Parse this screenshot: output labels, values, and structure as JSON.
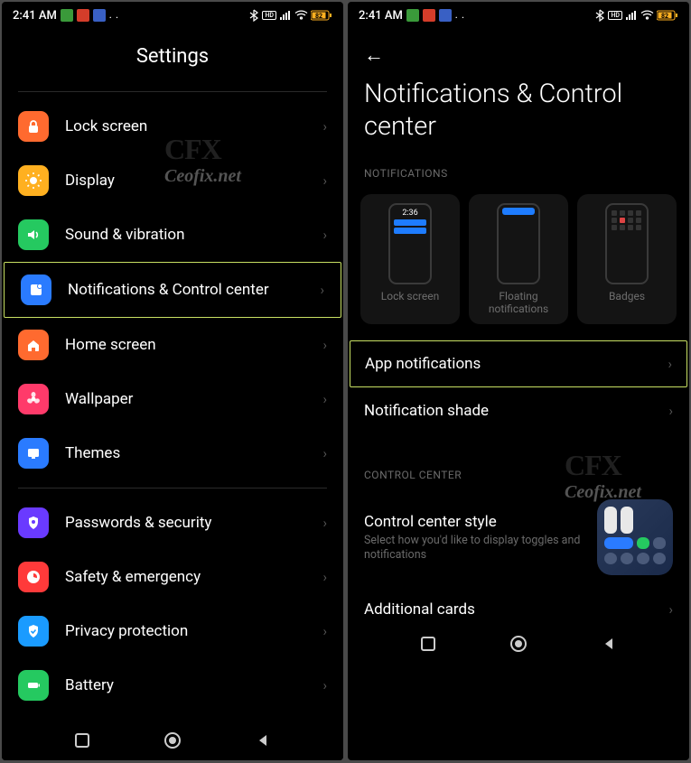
{
  "status": {
    "time": "2:41 AM",
    "app_icons": [
      "#3a9a3a",
      "#d43d2a",
      "#3960c4"
    ],
    "dots": ". .",
    "right_glyphs": [
      "bluetooth",
      "hd",
      "signal",
      "wifi",
      "battery"
    ],
    "battery_level": "82"
  },
  "left": {
    "title": "Settings",
    "items": [
      {
        "label": "Lock screen",
        "color": "#ff6a2f",
        "glyph": "lock"
      },
      {
        "label": "Display",
        "color": "#ffb020",
        "glyph": "sun"
      },
      {
        "label": "Sound & vibration",
        "color": "#25c960",
        "glyph": "sound"
      },
      {
        "label": "Notifications & Control center",
        "color": "#2a7bff",
        "glyph": "notif",
        "hl": true
      },
      {
        "label": "Home screen",
        "color": "#ff6a2f",
        "glyph": "home"
      },
      {
        "label": "Wallpaper",
        "color": "#ff3a6a",
        "glyph": "flower"
      },
      {
        "label": "Themes",
        "color": "#2a7bff",
        "glyph": "theme"
      }
    ],
    "items2": [
      {
        "label": "Passwords & security",
        "color": "#6a3aff",
        "glyph": "shield"
      },
      {
        "label": "Safety & emergency",
        "color": "#ff3a3a",
        "glyph": "safety"
      },
      {
        "label": "Privacy protection",
        "color": "#1a9bff",
        "glyph": "privacy"
      },
      {
        "label": "Battery",
        "color": "#25c960",
        "glyph": "battery"
      }
    ]
  },
  "right": {
    "title": "Notifications & Control center",
    "section1": "NOTIFICATIONS",
    "cards": [
      {
        "label": "Lock screen",
        "type": "lockscreen",
        "time": "2:36"
      },
      {
        "label": "Floating notifications",
        "type": "floating"
      },
      {
        "label": "Badges",
        "type": "badges"
      }
    ],
    "rows": [
      {
        "label": "App notifications",
        "hl": true
      },
      {
        "label": "Notification shade"
      }
    ],
    "section2": "CONTROL CENTER",
    "cc_title": "Control center style",
    "cc_sub": "Select how you'd like to display toggles and notifications",
    "additional": "Additional cards"
  },
  "watermark": {
    "top": "CFX",
    "bot": "Ceofix.net"
  }
}
